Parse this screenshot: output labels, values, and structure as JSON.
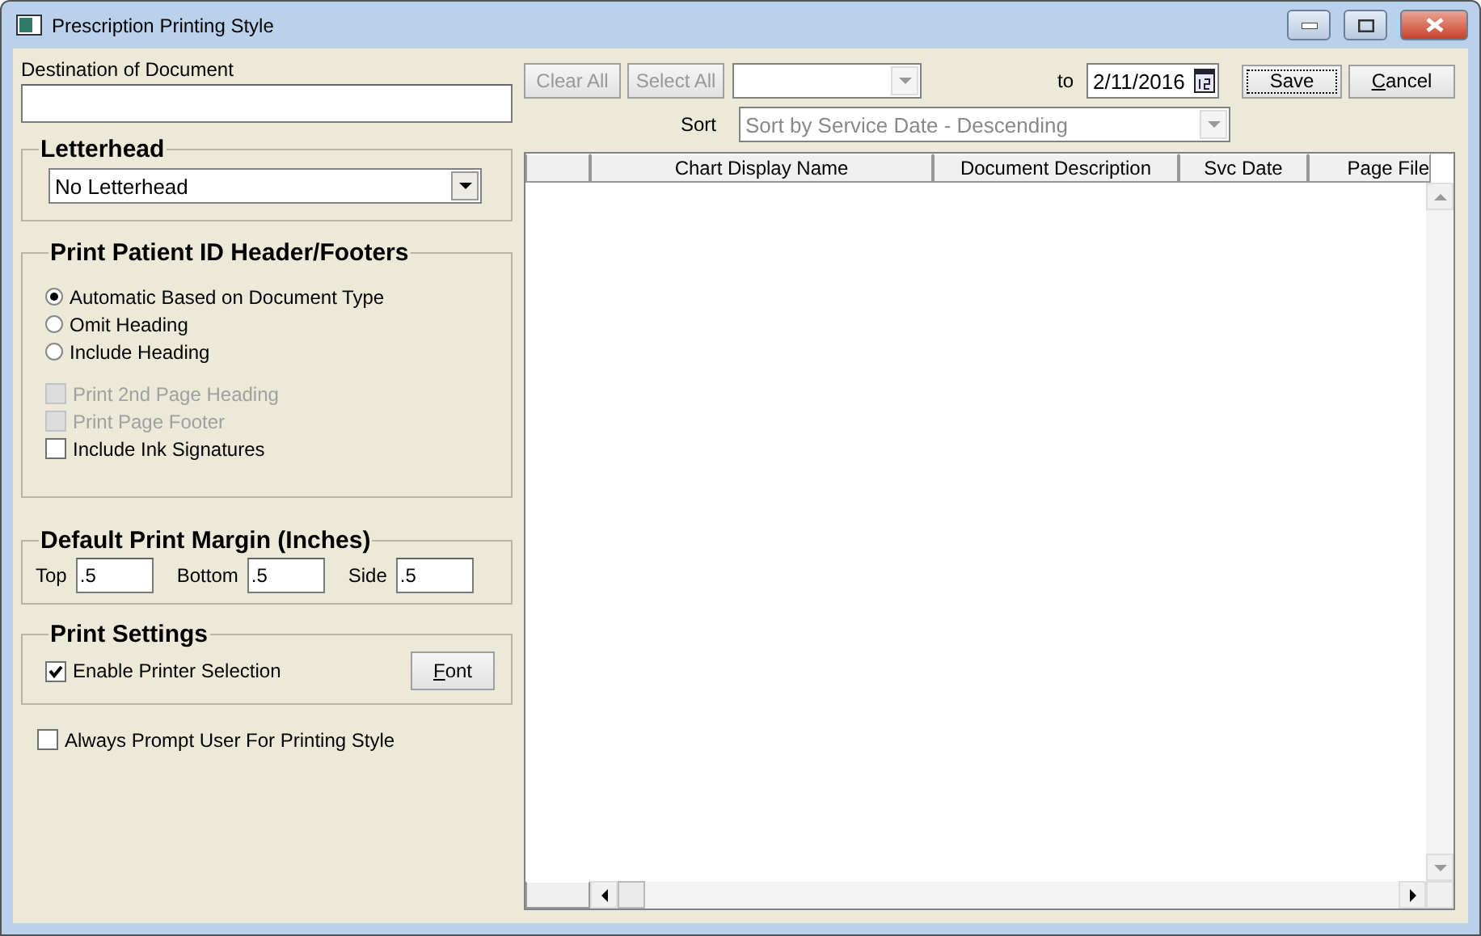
{
  "window": {
    "title": "Prescription Printing Style"
  },
  "destination": {
    "label": "Destination of Document"
  },
  "letterhead": {
    "title": "Letterhead",
    "value": "No Letterhead"
  },
  "header_footers": {
    "title": "Print Patient ID Header/Footers",
    "options": [
      {
        "label": "Automatic Based on Document Type",
        "selected": true
      },
      {
        "label": "Omit Heading",
        "selected": false
      },
      {
        "label": "Include Heading",
        "selected": false
      }
    ],
    "checkboxes": [
      {
        "label": "Print 2nd Page Heading",
        "checked": false,
        "disabled": true
      },
      {
        "label": "Print Page Footer",
        "checked": false,
        "disabled": true
      },
      {
        "label": "Include Ink Signatures",
        "checked": false,
        "disabled": false
      }
    ]
  },
  "margins": {
    "title": "Default Print Margin (Inches)",
    "fields": [
      {
        "label": "Top",
        "value": ".5"
      },
      {
        "label": "Bottom",
        "value": ".5"
      },
      {
        "label": "Side",
        "value": ".5"
      }
    ]
  },
  "print_settings": {
    "title": "Print Settings",
    "checkbox": {
      "label": "Enable Printer Selection",
      "checked": true
    },
    "font_button": "Font"
  },
  "always_prompt": {
    "label": "Always Prompt User For Printing Style",
    "checked": false
  },
  "toolbar": {
    "buttons": [
      {
        "label": "Clear All",
        "disabled": true
      },
      {
        "label": "Select All",
        "disabled": true
      }
    ],
    "to_label": "to",
    "date": "2/11/2016",
    "save": "Save",
    "cancel": "Cancel"
  },
  "sort": {
    "label": "Sort",
    "value": "Sort by Service Date - Descending"
  },
  "table": {
    "columns": [
      "Chart Display Name",
      "Document Description",
      "Svc Date",
      "Page File"
    ]
  }
}
